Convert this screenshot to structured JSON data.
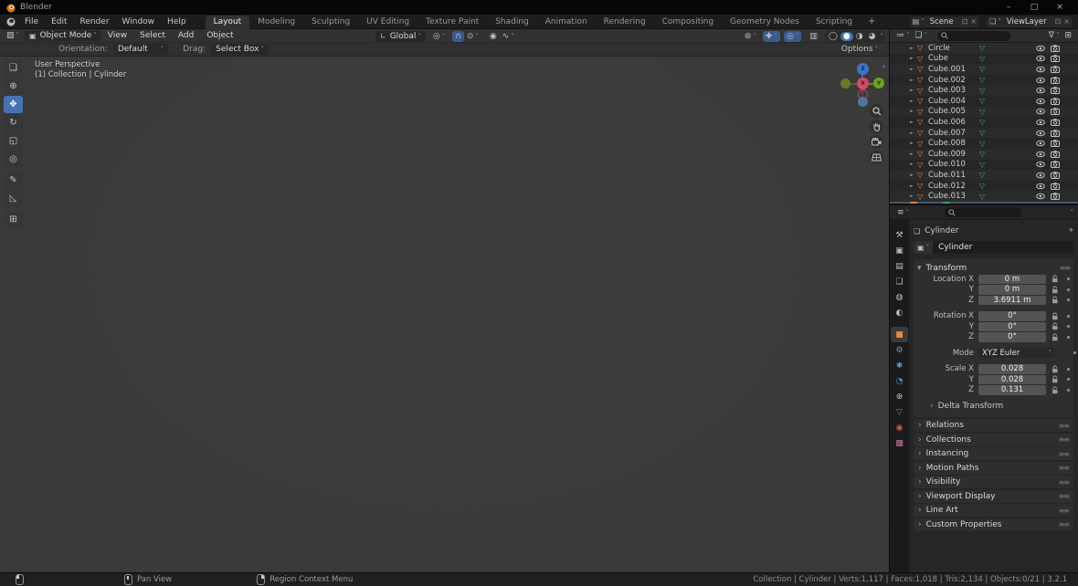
{
  "window": {
    "title": "Blender"
  },
  "window_controls": {
    "minimize": "–",
    "maximize": "□",
    "close": "×"
  },
  "icons": {
    "disclosure": "►",
    "mesh": "▽",
    "chevron_down": "˅",
    "chevron_right": "›",
    "panel_open": "▾",
    "collapse_left": "‹",
    "editor_viewport": "▧",
    "editor_outliner": "≔",
    "editor_properties": "≡",
    "display_mode": "❏",
    "funnel": "∇",
    "new_collection": "⊞",
    "mode_object": "▣",
    "orientation_axes": "∟",
    "pivot": "◎",
    "magnet": "∩",
    "snap_with": "⊙",
    "proportional": "◉",
    "falloff": "∿",
    "show_types": "⊚",
    "gizmos": "✚",
    "overlays": "◎",
    "xray": "▥",
    "shade_wireframe": "◯",
    "shade_solid": "●",
    "shade_material": "◑",
    "shade_rendered": "◕",
    "scene": "▤",
    "viewlayer": "❏",
    "copy": "⊡",
    "close_small": "×",
    "pin": "⌖",
    "grip": "≡≡",
    "breadcrumb_object": "❏"
  },
  "topbar": {
    "menus": [
      "File",
      "Edit",
      "Render",
      "Window",
      "Help"
    ],
    "tabs": [
      {
        "label": "Layout",
        "active": true
      },
      {
        "label": "Modeling"
      },
      {
        "label": "Sculpting"
      },
      {
        "label": "UV Editing"
      },
      {
        "label": "Texture Paint"
      },
      {
        "label": "Shading"
      },
      {
        "label": "Animation"
      },
      {
        "label": "Rendering"
      },
      {
        "label": "Compositing"
      },
      {
        "label": "Geometry Nodes"
      },
      {
        "label": "Scripting"
      }
    ],
    "add_tab_label": "+",
    "scene_label": "Scene",
    "viewlayer_label": "ViewLayer"
  },
  "viewport": {
    "mode_label": "Object Mode",
    "menus": [
      "View",
      "Select",
      "Add",
      "Object"
    ],
    "orientation_label": "Global",
    "options_label": "Options",
    "tool_settings": {
      "orientation_label": "Orientation:",
      "orientation_value": "Default",
      "drag_label": "Drag:",
      "drag_value": "Select Box"
    },
    "overlay_line1": "User Perspective",
    "overlay_line2": "(1) Collection | Cylinder",
    "gizmo": {
      "x": "X",
      "y": "Y",
      "z": "Z"
    }
  },
  "tools": [
    {
      "name": "select-box",
      "glyph": "❏"
    },
    {
      "name": "cursor",
      "glyph": "⊕"
    },
    {
      "name": "move",
      "glyph": "✥",
      "active": true
    },
    {
      "name": "rotate",
      "glyph": "↻"
    },
    {
      "name": "scale",
      "glyph": "◱"
    },
    {
      "name": "transform",
      "glyph": "◎"
    },
    {
      "name": "annotate",
      "glyph": "✎",
      "gap": true
    },
    {
      "name": "measure",
      "glyph": "◺"
    },
    {
      "name": "add-cube",
      "glyph": "⊞",
      "gap": true
    }
  ],
  "outliner": {
    "items": [
      {
        "name": "Circle"
      },
      {
        "name": "Cube"
      },
      {
        "name": "Cube.001"
      },
      {
        "name": "Cube.002"
      },
      {
        "name": "Cube.003"
      },
      {
        "name": "Cube.004"
      },
      {
        "name": "Cube.005"
      },
      {
        "name": "Cube.006"
      },
      {
        "name": "Cube.007"
      },
      {
        "name": "Cube.008"
      },
      {
        "name": "Cube.009"
      },
      {
        "name": "Cube.010"
      },
      {
        "name": "Cube.011"
      },
      {
        "name": "Cube.012"
      },
      {
        "name": "Cube.013"
      }
    ]
  },
  "properties": {
    "breadcrumb": "Cylinder",
    "object_name": "Cylinder",
    "tabs": [
      {
        "name": "tool",
        "glyph": "⚒",
        "color": "#bdbdbd"
      },
      {
        "name": "render",
        "glyph": "▣",
        "color": "#bdbdbd"
      },
      {
        "name": "output",
        "glyph": "▤",
        "color": "#bdbdbd"
      },
      {
        "name": "view-layer",
        "glyph": "❏",
        "color": "#bdbdbd"
      },
      {
        "name": "scene",
        "glyph": "◍",
        "color": "#bdbdbd"
      },
      {
        "name": "world",
        "glyph": "◐",
        "color": "#bdbdbd"
      },
      {
        "name": "object",
        "glyph": "■",
        "color": "#e8853e",
        "active": true,
        "gap": true
      },
      {
        "name": "modifiers",
        "glyph": "⚙",
        "color": "#6b9bd2"
      },
      {
        "name": "particles",
        "glyph": "✱",
        "color": "#5f96c9"
      },
      {
        "name": "physics",
        "glyph": "◔",
        "color": "#5f96c9"
      },
      {
        "name": "constraints",
        "glyph": "⊕",
        "color": "#a8c0d8"
      },
      {
        "name": "data",
        "glyph": "▽",
        "color": "#36a473"
      },
      {
        "name": "material",
        "glyph": "◉",
        "color": "#c95f5f"
      },
      {
        "name": "texture",
        "glyph": "▩",
        "color": "#d06a9f"
      }
    ],
    "transform": {
      "title": "Transform",
      "location": [
        {
          "label": "Location X",
          "value": "0 m"
        },
        {
          "label": "Y",
          "value": "0 m"
        },
        {
          "label": "Z",
          "value": "3.6911 m"
        }
      ],
      "rotation": [
        {
          "label": "Rotation X",
          "value": "0°"
        },
        {
          "label": "Y",
          "value": "0°"
        },
        {
          "label": "Z",
          "value": "0°"
        }
      ],
      "mode_label": "Mode",
      "mode_value": "XYZ Euler",
      "scale": [
        {
          "label": "Scale X",
          "value": "0.028"
        },
        {
          "label": "Y",
          "value": "0.028"
        },
        {
          "label": "Z",
          "value": "0.131"
        }
      ],
      "delta_label": "Delta Transform"
    },
    "panels": [
      {
        "label": "Relations"
      },
      {
        "label": "Collections"
      },
      {
        "label": "Instancing"
      },
      {
        "label": "Motion Paths"
      },
      {
        "label": "Visibility"
      },
      {
        "label": "Viewport Display"
      },
      {
        "label": "Line Art"
      },
      {
        "label": "Custom Properties"
      }
    ]
  },
  "statusbar": {
    "pan_label": "Pan View",
    "context_label": "Region Context Menu",
    "stats": "Collection | Cylinder | Verts:1,117 | Faces:1,018 | Tris:2,134 | Objects:0/21 | 3.2.1"
  },
  "colors": {
    "accent": "#4772b3",
    "object_orange": "#e8853e",
    "data_green": "#36a473",
    "axis_x": "#d94a66",
    "axis_y": "#6fa21c",
    "axis_z": "#3e74c9"
  }
}
